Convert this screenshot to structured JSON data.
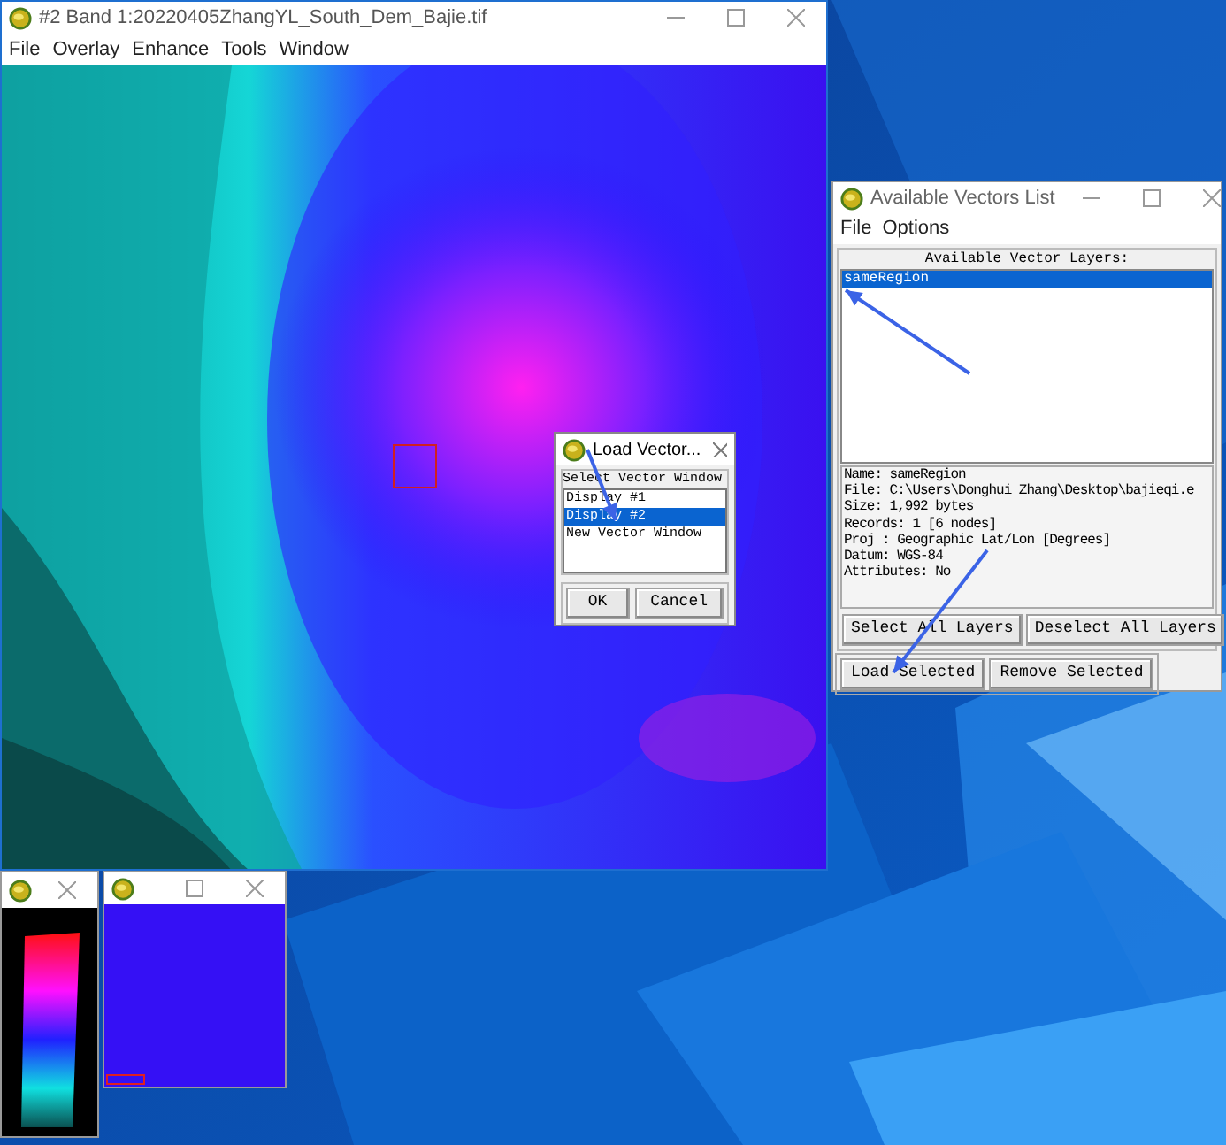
{
  "main_window": {
    "title": "#2 Band 1:20220405ZhangYL_South_Dem_Bajie.tif",
    "menu": [
      "File",
      "Overlay",
      "Enhance",
      "Tools",
      "Window"
    ]
  },
  "load_dialog": {
    "title": "Load Vector...",
    "label": "Select Vector Window",
    "items": [
      {
        "label": "Display #1",
        "selected": false
      },
      {
        "label": "Display #2",
        "selected": true
      },
      {
        "label": "New Vector Window",
        "selected": false
      }
    ],
    "buttons": [
      "OK",
      "Cancel"
    ]
  },
  "vectors_window": {
    "title": "Available Vectors List",
    "menu": [
      "File",
      "Options"
    ],
    "list_header": "Available Vector Layers:",
    "layers": [
      {
        "label": "sameRegion",
        "selected": true
      }
    ],
    "info": [
      "Name: sameRegion",
      "File: C:\\Users\\Donghui Zhang\\Desktop\\bajieqi.e",
      "Size: 1,992 bytes",
      "Records: 1 [6 nodes]",
      "Proj : Geographic Lat/Lon [Degrees]",
      "Datum: WGS-84",
      "Attributes: No"
    ],
    "select_buttons": [
      "Select All Layers",
      "Deselect All Layers"
    ],
    "action_buttons": [
      "Load Selected",
      "Remove Selected"
    ]
  }
}
